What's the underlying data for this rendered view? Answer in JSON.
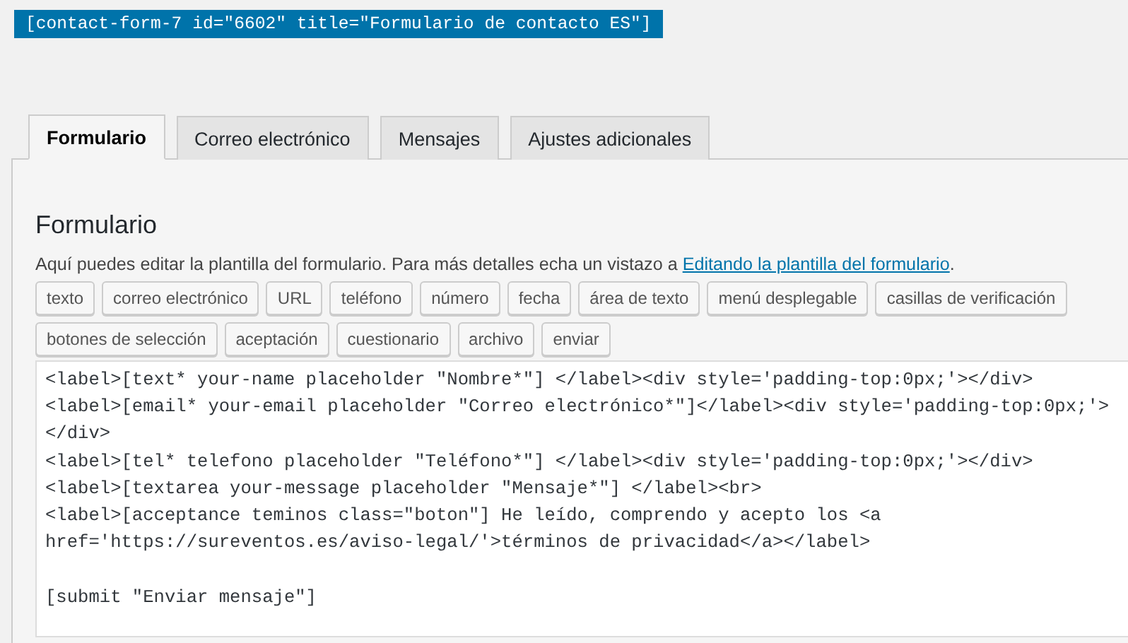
{
  "shortcode": "[contact-form-7 id=\"6602\" title=\"Formulario de contacto ES\"]",
  "tabs": [
    {
      "label": "Formulario",
      "selected": true
    },
    {
      "label": "Correo electrónico",
      "selected": false
    },
    {
      "label": "Mensajes",
      "selected": false
    },
    {
      "label": "Ajustes adicionales",
      "selected": false
    }
  ],
  "panel": {
    "heading": "Formulario",
    "description": "Aquí puedes editar la plantilla del formulario. Para más detalles echa un vistazo a ",
    "link": "Editando la plantilla del formulario",
    "description_end": ".",
    "tag_buttons": [
      [
        "texto",
        "correo electrónico",
        "URL",
        "teléfono",
        "número",
        "fecha",
        "área de texto",
        "menú desplegable",
        "casillas de verificación"
      ],
      [
        "botones de selección",
        "aceptación",
        "cuestionario",
        "archivo",
        "enviar"
      ]
    ],
    "editor_lines": [
      "<label>[text* your-name placeholder \"Nombre*\"] </label><div style='padding-top:0px;'></div>",
      "<label>[email* your-email placeholder \"Correo electrónico*\"]</label><div style='padding-top:0px;'>",
      "</div>",
      "<label>[tel* telefono placeholder \"Teléfono*\"] </label><div style='padding-top:0px;'></div>",
      "<label>[textarea your-message placeholder \"Mensaje*\"] </label><br>",
      "<label>[acceptance teminos class=\"boton\"] He leído, comprendo y acepto los <a",
      "href='https://sureventos.es/aviso-legal/'>términos de privacidad</a></label>"
    ],
    "submit_line": "[submit \"Enviar mensaje\"]"
  }
}
